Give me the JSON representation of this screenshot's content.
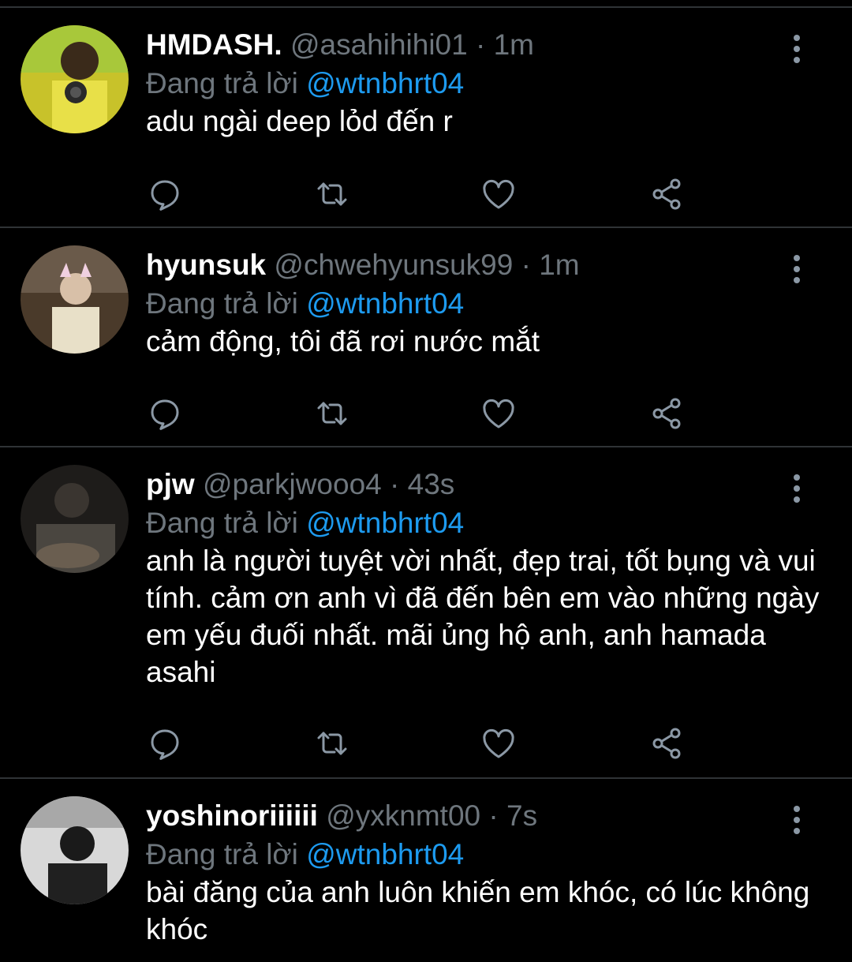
{
  "tweets": [
    {
      "name": "HMDASH.",
      "handle": "@asahihihi01",
      "time": "1m",
      "reply_prefix": "Đang trả lời",
      "reply_to": "@wtnbhrt04",
      "text": "adu ngài deep lỏd đến r"
    },
    {
      "name": "hyunsuk",
      "handle": "@chwehyunsuk99",
      "time": "1m",
      "reply_prefix": "Đang trả lời",
      "reply_to": "@wtnbhrt04",
      "text": "cảm động, tôi đã rơi nước mắt"
    },
    {
      "name": "pjw",
      "handle": "@parkjwooo4",
      "time": "43s",
      "reply_prefix": "Đang trả lời",
      "reply_to": "@wtnbhrt04",
      "text": "anh là người tuyệt vời nhất, đẹp trai, tốt bụng và vui tính. cảm ơn anh vì đã đến bên em vào những ngày em yếu đuối nhất. mãi ủng hộ anh, anh hamada asahi"
    },
    {
      "name": "yoshinoriiiiii",
      "handle": "@yxknmt00",
      "time": "7s",
      "reply_prefix": "Đang trả lời",
      "reply_to": "@wtnbhrt04",
      "text": "bài đăng của anh luôn khiến em khóc, có lúc không khóc"
    }
  ],
  "separator": "·",
  "icons": {
    "reply": "reply-icon",
    "retweet": "retweet-icon",
    "like": "heart-icon",
    "share": "share-icon",
    "more": "more-vertical-icon"
  },
  "colors": {
    "background": "#000000",
    "name": "#ffffff",
    "muted": "#6e767d",
    "mention": "#1d9bf0",
    "divider": "#2f3336"
  }
}
